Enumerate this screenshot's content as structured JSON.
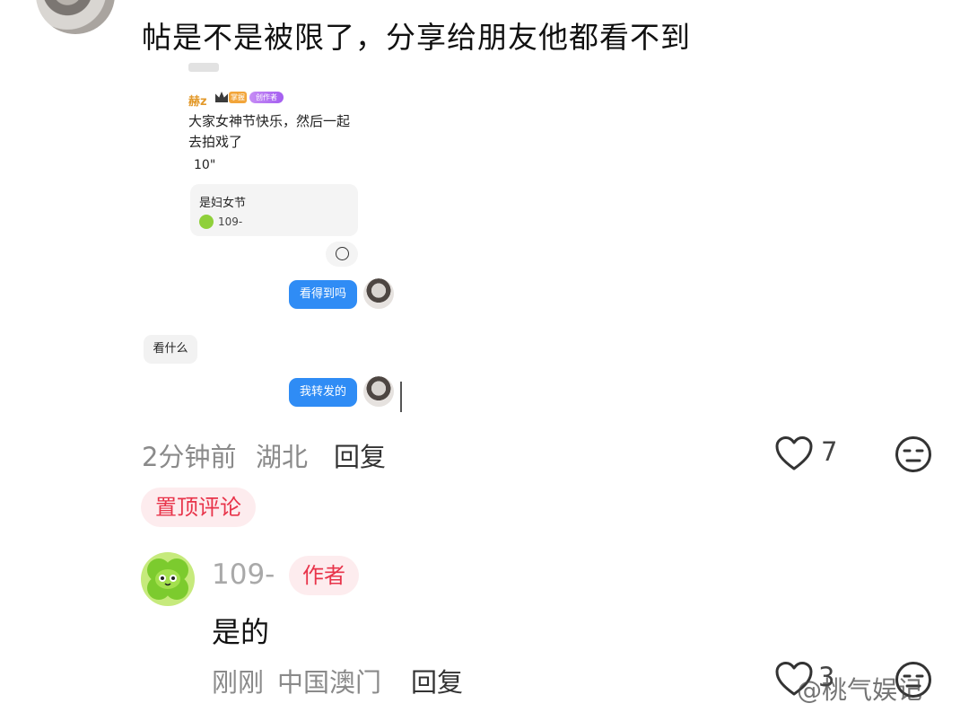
{
  "comment": {
    "text": "帖是不是被限了，分享给朋友他都看不到",
    "time": "2分钟前",
    "location": "湖北",
    "reply_label": "回复",
    "like_count": "7",
    "pinned_label": "置顶评论"
  },
  "screenshot": {
    "post_user": "赫z",
    "tag_orange": "掌握",
    "tag_purple": "创作者",
    "post_line1": "大家女神节快乐，然后一起",
    "post_line2": "去拍戏了",
    "duration": "10\"",
    "card_title": "是妇女节",
    "card_name": "109-",
    "bubble1": "看得到吗",
    "bubble_gray": "看什么",
    "bubble2": "我转发的"
  },
  "reply": {
    "name": "109-",
    "badge": "作者",
    "text": "是的",
    "time": "刚刚",
    "location": "中国澳门",
    "reply_label": "回复",
    "like_count": "3"
  },
  "watermark": "@桃气娱记",
  "icons": [
    "heart-icon",
    "dislike-face-icon",
    "emoji-icon"
  ]
}
